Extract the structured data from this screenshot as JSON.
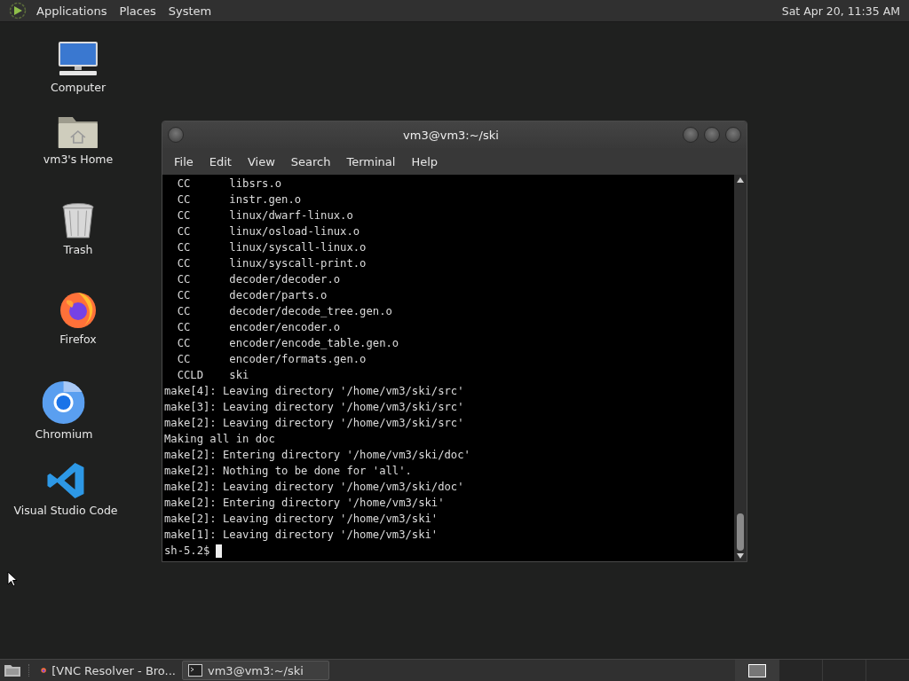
{
  "top_panel": {
    "menus": [
      "Applications",
      "Places",
      "System"
    ],
    "clock": "Sat Apr 20, 11:35 AM"
  },
  "desktop_icons": [
    {
      "label": "Computer",
      "kind": "computer"
    },
    {
      "label": "vm3's Home",
      "kind": "home"
    },
    {
      "label": "Trash",
      "kind": "trash"
    },
    {
      "label": "Firefox",
      "kind": "firefox"
    },
    {
      "label": "Chromium",
      "kind": "chromium"
    },
    {
      "label": "Visual Studio Code",
      "kind": "vscode"
    }
  ],
  "window": {
    "title": "vm3@vm3:~/ski",
    "menu": [
      "File",
      "Edit",
      "View",
      "Search",
      "Terminal",
      "Help"
    ],
    "lines": [
      "  CC      libsrs.o",
      "  CC      instr.gen.o",
      "  CC      linux/dwarf-linux.o",
      "  CC      linux/osload-linux.o",
      "  CC      linux/syscall-linux.o",
      "  CC      linux/syscall-print.o",
      "  CC      decoder/decoder.o",
      "  CC      decoder/parts.o",
      "  CC      decoder/decode_tree.gen.o",
      "  CC      encoder/encoder.o",
      "  CC      encoder/encode_table.gen.o",
      "  CC      encoder/formats.gen.o",
      "  CCLD    ski",
      "make[4]: Leaving directory '/home/vm3/ski/src'",
      "make[3]: Leaving directory '/home/vm3/ski/src'",
      "make[2]: Leaving directory '/home/vm3/ski/src'",
      "Making all in doc",
      "make[2]: Entering directory '/home/vm3/ski/doc'",
      "make[2]: Nothing to be done for 'all'.",
      "make[2]: Leaving directory '/home/vm3/ski/doc'",
      "make[2]: Entering directory '/home/vm3/ski'",
      "make[2]: Leaving directory '/home/vm3/ski'",
      "make[1]: Leaving directory '/home/vm3/ski'"
    ],
    "prompt": "sh-5.2$"
  },
  "taskbar": {
    "tasks": [
      {
        "label": "[VNC Resolver - Bro...",
        "kind": "browser",
        "selected": false
      },
      {
        "label": "vm3@vm3:~/ski",
        "kind": "terminal",
        "selected": true
      }
    ],
    "workspaces": [
      {
        "selected": true
      },
      {
        "selected": false
      },
      {
        "selected": false
      },
      {
        "selected": false
      }
    ]
  }
}
